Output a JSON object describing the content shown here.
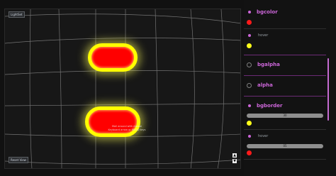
{
  "viewport": {
    "top_label": "LightSet",
    "bottom_label": "Reset View",
    "hint_line1": "Mall around with mouse",
    "hint_line2": "Keyboard arrow or WASD keys",
    "nav_up": "▲",
    "nav_down": "▼"
  },
  "panel": {
    "bgcolor_label": "bgcolor",
    "hover1_label": "hover",
    "bgalpha_label": "bgalpha",
    "alpha_label": "alpha",
    "bgborder_label": "bgborder",
    "slider1_value": "30",
    "hover2_label": "hover",
    "slider2_value": "05",
    "colors": {
      "accent": "#cc66d9",
      "red": "#ff1a1a",
      "yellow": "#ffff1a"
    }
  }
}
